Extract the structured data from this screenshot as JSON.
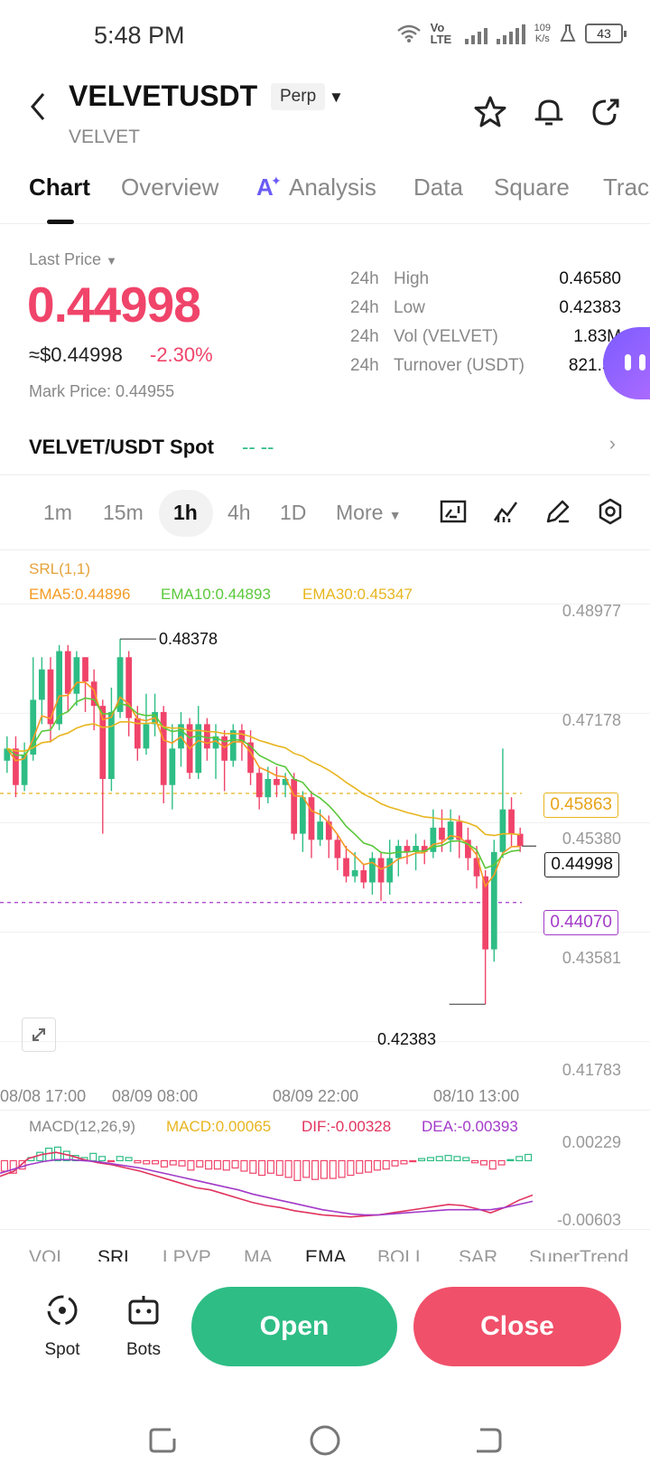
{
  "status": {
    "time": "5:48 PM",
    "net": "Vo LTE",
    "speed_top": "109",
    "speed_bottom": "K/s",
    "battery": "43"
  },
  "header": {
    "symbol": "VELVETUSDT",
    "type": "Perp",
    "base": "VELVET"
  },
  "tabs": [
    {
      "label": "Chart"
    },
    {
      "label": "Overview"
    },
    {
      "label": "Analysis"
    },
    {
      "label": "Data"
    },
    {
      "label": "Square"
    },
    {
      "label": "Trac"
    }
  ],
  "price": {
    "label": "Last Price",
    "last": "0.44998",
    "usd": "≈$0.44998",
    "change": "-2.30%",
    "mark": "Mark Price: 0.44955"
  },
  "stats": [
    {
      "period": "24h",
      "key": "High",
      "value": "0.46580"
    },
    {
      "period": "24h",
      "key": "Low",
      "value": "0.42383"
    },
    {
      "period": "24h",
      "key": "Vol (VELVET)",
      "value": "1.83M"
    },
    {
      "period": "24h",
      "key": "Turnover (USDT)",
      "value": "821.53"
    }
  ],
  "spot": {
    "name": "VELVET/USDT Spot",
    "value": "-- --"
  },
  "timeframes": [
    {
      "label": "1m"
    },
    {
      "label": "15m"
    },
    {
      "label": "1h"
    },
    {
      "label": "4h"
    },
    {
      "label": "1D"
    },
    {
      "label": "More"
    }
  ],
  "legend": {
    "srl": "SRL(1,1)",
    "ema5": "EMA5:0.44896",
    "ema10": "EMA10:0.44893",
    "ema30": "EMA30:0.45347"
  },
  "colors": {
    "up": "#2ebd85",
    "down": "#f0446a",
    "ema5": "#f59a23",
    "ema10": "#5ac83a",
    "ema30": "#e8b51f",
    "dif": "#e0345e",
    "dea": "#a23ac9"
  },
  "chart_data": {
    "type": "candlestick",
    "y_ticks": [
      "0.48977",
      "0.47178",
      "0.45380",
      "0.43581",
      "0.41783"
    ],
    "ylim": [
      0.4178,
      0.4898
    ],
    "x_ticks": [
      "08/08 17:00",
      "08/09 08:00",
      "08/09 22:00",
      "08/10 13:00"
    ],
    "high_label": "0.48378",
    "low_label": "0.42383",
    "current_tag": "0.44998",
    "line_tag_1": "0.45863",
    "line_tag_2": "0.44070",
    "candles": [
      [
        0.464,
        0.466,
        0.468,
        0.462
      ],
      [
        0.466,
        0.46,
        0.468,
        0.458
      ],
      [
        0.46,
        0.465,
        0.467,
        0.459
      ],
      [
        0.465,
        0.474,
        0.481,
        0.464
      ],
      [
        0.474,
        0.479,
        0.481,
        0.47
      ],
      [
        0.479,
        0.47,
        0.481,
        0.467
      ],
      [
        0.47,
        0.482,
        0.483,
        0.469
      ],
      [
        0.482,
        0.475,
        0.483,
        0.472
      ],
      [
        0.475,
        0.481,
        0.482,
        0.473
      ],
      [
        0.481,
        0.477,
        0.481,
        0.472
      ],
      [
        0.477,
        0.473,
        0.479,
        0.469
      ],
      [
        0.473,
        0.461,
        0.474,
        0.452
      ],
      [
        0.461,
        0.472,
        0.476,
        0.459
      ],
      [
        0.472,
        0.481,
        0.484,
        0.471
      ],
      [
        0.481,
        0.471,
        0.482,
        0.468
      ],
      [
        0.471,
        0.466,
        0.473,
        0.464
      ],
      [
        0.466,
        0.47,
        0.475,
        0.465
      ],
      [
        0.47,
        0.472,
        0.475,
        0.468
      ],
      [
        0.472,
        0.46,
        0.473,
        0.457
      ],
      [
        0.46,
        0.466,
        0.47,
        0.456
      ],
      [
        0.466,
        0.47,
        0.472,
        0.463
      ],
      [
        0.47,
        0.462,
        0.471,
        0.461
      ],
      [
        0.462,
        0.47,
        0.473,
        0.461
      ],
      [
        0.47,
        0.466,
        0.471,
        0.464
      ],
      [
        0.466,
        0.468,
        0.47,
        0.461
      ],
      [
        0.468,
        0.464,
        0.469,
        0.459
      ],
      [
        0.464,
        0.469,
        0.47,
        0.463
      ],
      [
        0.469,
        0.467,
        0.47,
        0.464
      ],
      [
        0.467,
        0.462,
        0.469,
        0.46
      ],
      [
        0.462,
        0.458,
        0.463,
        0.456
      ],
      [
        0.458,
        0.461,
        0.463,
        0.457
      ],
      [
        0.461,
        0.46,
        0.463,
        0.458
      ],
      [
        0.46,
        0.461,
        0.462,
        0.458
      ],
      [
        0.461,
        0.452,
        0.462,
        0.451
      ],
      [
        0.452,
        0.458,
        0.459,
        0.449
      ],
      [
        0.458,
        0.451,
        0.459,
        0.448
      ],
      [
        0.451,
        0.454,
        0.456,
        0.45
      ],
      [
        0.454,
        0.451,
        0.455,
        0.448
      ],
      [
        0.451,
        0.448,
        0.452,
        0.446
      ],
      [
        0.448,
        0.445,
        0.45,
        0.444
      ],
      [
        0.445,
        0.446,
        0.449,
        0.444
      ],
      [
        0.446,
        0.444,
        0.447,
        0.443
      ],
      [
        0.444,
        0.448,
        0.449,
        0.442
      ],
      [
        0.448,
        0.444,
        0.449,
        0.441
      ],
      [
        0.444,
        0.448,
        0.451,
        0.442
      ],
      [
        0.448,
        0.45,
        0.451,
        0.445
      ],
      [
        0.45,
        0.449,
        0.451,
        0.447
      ],
      [
        0.449,
        0.45,
        0.452,
        0.446
      ],
      [
        0.45,
        0.449,
        0.451,
        0.447
      ],
      [
        0.449,
        0.453,
        0.456,
        0.448
      ],
      [
        0.453,
        0.451,
        0.456,
        0.449
      ],
      [
        0.451,
        0.454,
        0.456,
        0.449
      ],
      [
        0.454,
        0.451,
        0.455,
        0.448
      ],
      [
        0.451,
        0.448,
        0.453,
        0.446
      ],
      [
        0.448,
        0.445,
        0.45,
        0.443
      ],
      [
        0.445,
        0.433,
        0.446,
        0.424
      ],
      [
        0.433,
        0.449,
        0.451,
        0.431
      ],
      [
        0.449,
        0.456,
        0.466,
        0.448
      ],
      [
        0.456,
        0.452,
        0.458,
        0.45
      ],
      [
        0.452,
        0.45,
        0.453,
        0.449
      ]
    ]
  },
  "macd": {
    "label": "MACD(12,26,9)",
    "macd": "MACD:0.00065",
    "dif": "DIF:-0.00328",
    "dea": "DEA:-0.00393",
    "y_top": "0.00229",
    "y_bottom": "-0.00603",
    "hist": [
      -0.001,
      -0.0012,
      -0.0008,
      0.0003,
      0.0008,
      0.0012,
      0.0013,
      0.0009,
      0.0005,
      0.0003,
      0.0007,
      0.0004,
      -0.0001,
      0.0004,
      0.0003,
      -0.0002,
      -0.0003,
      -0.0003,
      -0.0006,
      -0.0004,
      -0.0005,
      -0.0009,
      -0.0006,
      -0.0008,
      -0.0008,
      -0.0009,
      -0.0007,
      -0.001,
      -0.0012,
      -0.0014,
      -0.0012,
      -0.0014,
      -0.0016,
      -0.0019,
      -0.0016,
      -0.0018,
      -0.0017,
      -0.0017,
      -0.0016,
      -0.0014,
      -0.0012,
      -0.0011,
      -0.0009,
      -0.0008,
      -0.0005,
      -0.0003,
      -0.0001,
      0.0002,
      0.0003,
      0.0004,
      0.0005,
      0.0004,
      0.0003,
      -0.0002,
      -0.0004,
      -0.0008,
      -0.0004,
      0.0001,
      0.0004,
      0.0006
    ],
    "dif_series": [
      -0.0015,
      -0.001,
      0.0002,
      0.0006,
      0.0008,
      0.0005,
      0.0001,
      -0.0002,
      -0.0004,
      -0.0007,
      -0.001,
      -0.0014,
      -0.0018,
      -0.0022,
      -0.0026,
      -0.0028,
      -0.0032,
      -0.0036,
      -0.004,
      -0.0043,
      -0.0045,
      -0.0048,
      -0.005,
      -0.0052,
      -0.0053,
      -0.0054,
      -0.0053,
      -0.0052,
      -0.005,
      -0.0048,
      -0.0046,
      -0.0044,
      -0.0042,
      -0.0043,
      -0.0046,
      -0.005,
      -0.0045,
      -0.0038,
      -0.0033
    ],
    "dea_series": [
      -0.0012,
      -0.0008,
      -0.0004,
      -0.0001,
      0.0001,
      0.0001,
      0.0,
      -0.0001,
      -0.0003,
      -0.0005,
      -0.0007,
      -0.001,
      -0.0013,
      -0.0016,
      -0.0019,
      -0.0022,
      -0.0025,
      -0.0028,
      -0.0032,
      -0.0035,
      -0.0038,
      -0.0041,
      -0.0044,
      -0.0047,
      -0.0049,
      -0.0051,
      -0.0052,
      -0.0052,
      -0.0051,
      -0.005,
      -0.0049,
      -0.0048,
      -0.0047,
      -0.0047,
      -0.0047,
      -0.0047,
      -0.0045,
      -0.0042,
      -0.0039
    ]
  },
  "indicators": [
    {
      "label": "VOL"
    },
    {
      "label": "SRL"
    },
    {
      "label": "LPVP"
    },
    {
      "label": "MA"
    },
    {
      "label": "EMA"
    },
    {
      "label": "BOLL"
    },
    {
      "label": "SAR"
    },
    {
      "label": "SuperTrend"
    }
  ],
  "bottom": {
    "spot": "Spot",
    "bots": "Bots",
    "open": "Open",
    "close": "Close"
  }
}
